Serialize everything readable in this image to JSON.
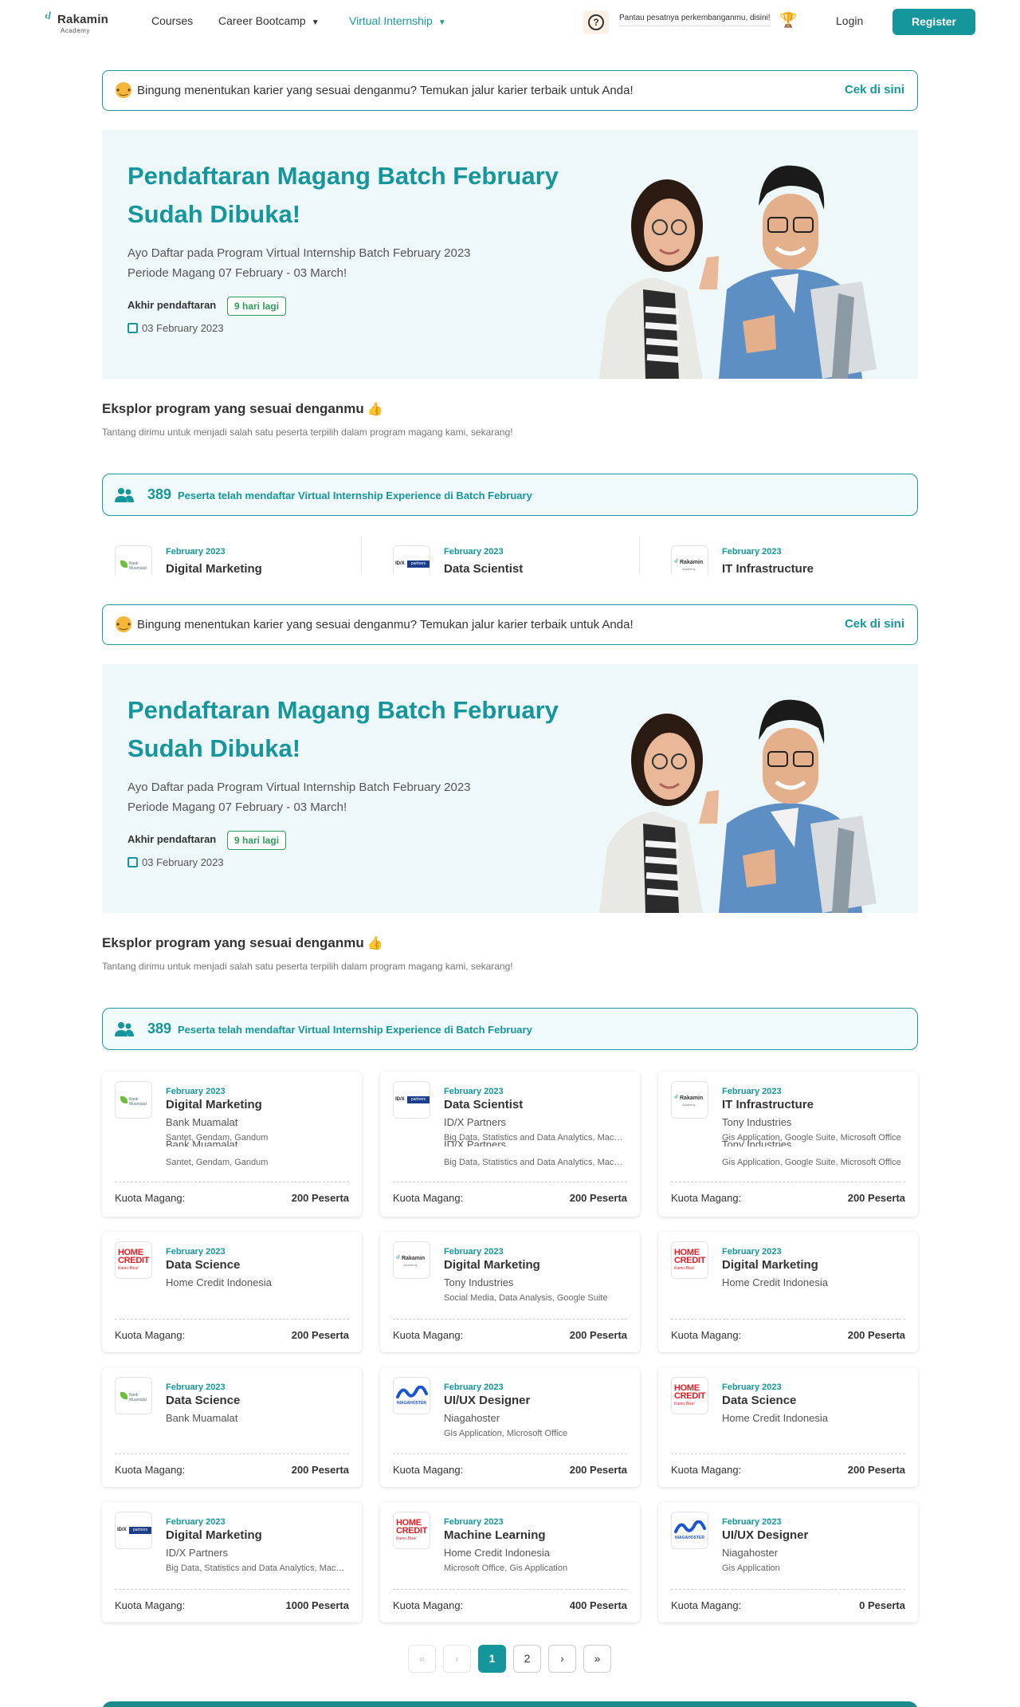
{
  "navbar": {
    "logo_name": "Rakamin",
    "logo_sub": "Academy",
    "items": [
      "Courses",
      "Career Bootcamp",
      "Virtual Internship"
    ],
    "track_text": "Pantau pesatnya perkembanganmu, disini!",
    "login": "Login",
    "register": "Register"
  },
  "career_banner": {
    "message": "Bingung menentukan karier yang sesuai denganmu? Temukan jalur karier terbaik untuk Anda!",
    "cta": "Cek di sini"
  },
  "hero": {
    "title": "Pendaftaran Magang Batch February Sudah Dibuka!",
    "description": "Ayo Daftar pada Program Virtual Internship Batch February 2023 Periode Magang 07 February - 03 March!",
    "deadline_label": "Akhir pendaftaran",
    "deadline_badge": "9 hari lagi",
    "date": "03 February 2023"
  },
  "explore": {
    "title": "Eksplor program yang sesuai denganmu",
    "subtitle": "Tantang dirimu untuk menjadi salah satu peserta terpilih dalam program magang kami, sekarang!"
  },
  "count_banner": {
    "count": "389",
    "text": "Peserta telah mendaftar Virtual Internship Experience di Batch February"
  },
  "quota_label": "Kuota Magang:",
  "partial_cards": [
    {
      "period": "February 2023",
      "title": "Digital Marketing",
      "logo": "bank-muamalat"
    },
    {
      "period": "February 2023",
      "title": "Data Scientist",
      "logo": "idx-partners"
    },
    {
      "period": "February 2023",
      "title": "IT Infrastructure",
      "logo": "rakamin"
    }
  ],
  "cards": [
    {
      "period": "February 2023",
      "title": "Digital Marketing",
      "company": "Bank Muamalat",
      "skills": "Santet, Gendam, Gandum",
      "quota": "200 Peserta",
      "logo": "bank-muamalat"
    },
    {
      "period": "February 2023",
      "title": "Data Scientist",
      "company": "ID/X Partners",
      "skills": "Big Data, Statistics and Data Analytics, Machine Learning",
      "quota": "200 Peserta",
      "logo": "idx-partners"
    },
    {
      "period": "February 2023",
      "title": "IT Infrastructure",
      "company": "Tony Industries",
      "skills": "Gis Application, Google Suite, Microsoft Office",
      "quota": "200 Peserta",
      "logo": "rakamin"
    },
    {
      "period": "February 2023",
      "title": "Data Science",
      "company": "Home Credit Indonesia",
      "skills": "",
      "quota": "200 Peserta",
      "logo": "home-credit"
    },
    {
      "period": "February 2023",
      "title": "Digital Marketing",
      "company": "Tony Industries",
      "skills": "Social Media, Data Analysis, Google Suite",
      "quota": "200 Peserta",
      "logo": "rakamin"
    },
    {
      "period": "February 2023",
      "title": "Digital Marketing",
      "company": "Home Credit Indonesia",
      "skills": "",
      "quota": "200 Peserta",
      "logo": "home-credit"
    },
    {
      "period": "February 2023",
      "title": "Data Science",
      "company": "Bank Muamalat",
      "skills": "",
      "quota": "200 Peserta",
      "logo": "bank-muamalat"
    },
    {
      "period": "February 2023",
      "title": "UI/UX Designer",
      "company": "Niagahoster",
      "skills": "Gis Application, Microsoft Office",
      "quota": "200 Peserta",
      "logo": "niagahoster"
    },
    {
      "period": "February 2023",
      "title": "Data Science",
      "company": "Home Credit Indonesia",
      "skills": "",
      "quota": "200 Peserta",
      "logo": "home-credit"
    },
    {
      "period": "February 2023",
      "title": "Digital Marketing",
      "company": "ID/X Partners",
      "skills": "Big Data, Statistics and Data Analytics, Machine Learning",
      "quota": "1000 Peserta",
      "logo": "idx-partners"
    },
    {
      "period": "February 2023",
      "title": "Machine Learning",
      "company": "Home Credit Indonesia",
      "skills": "Microsoft Office, Gis Application",
      "quota": "400 Peserta",
      "logo": "home-credit"
    },
    {
      "period": "February 2023",
      "title": "UI/UX Designer",
      "company": "Niagahoster",
      "skills": "Gis Application",
      "quota": "0 Peserta",
      "logo": "niagahoster"
    }
  ],
  "logo_text": {
    "bank_muamalat": "Bank Muamalat",
    "idx_a": "ID/X",
    "idx_b": "partners",
    "rakamin": "Rakamin",
    "rakamin_sub": "Academy",
    "hc_1": "HOME",
    "hc_2": "CREDIT",
    "hc_3": "Kamu Bisa!",
    "niagahoster": "NIAGAHOSTER"
  },
  "pagination": {
    "first": "«",
    "prev": "‹",
    "pages": [
      "1",
      "2"
    ],
    "current": "1",
    "next": "›",
    "last": "»"
  },
  "colors": {
    "primary": "#15969c",
    "success": "#2e9c5b",
    "hero_bg": "#eef8f8",
    "home_credit": "#e01f26"
  }
}
